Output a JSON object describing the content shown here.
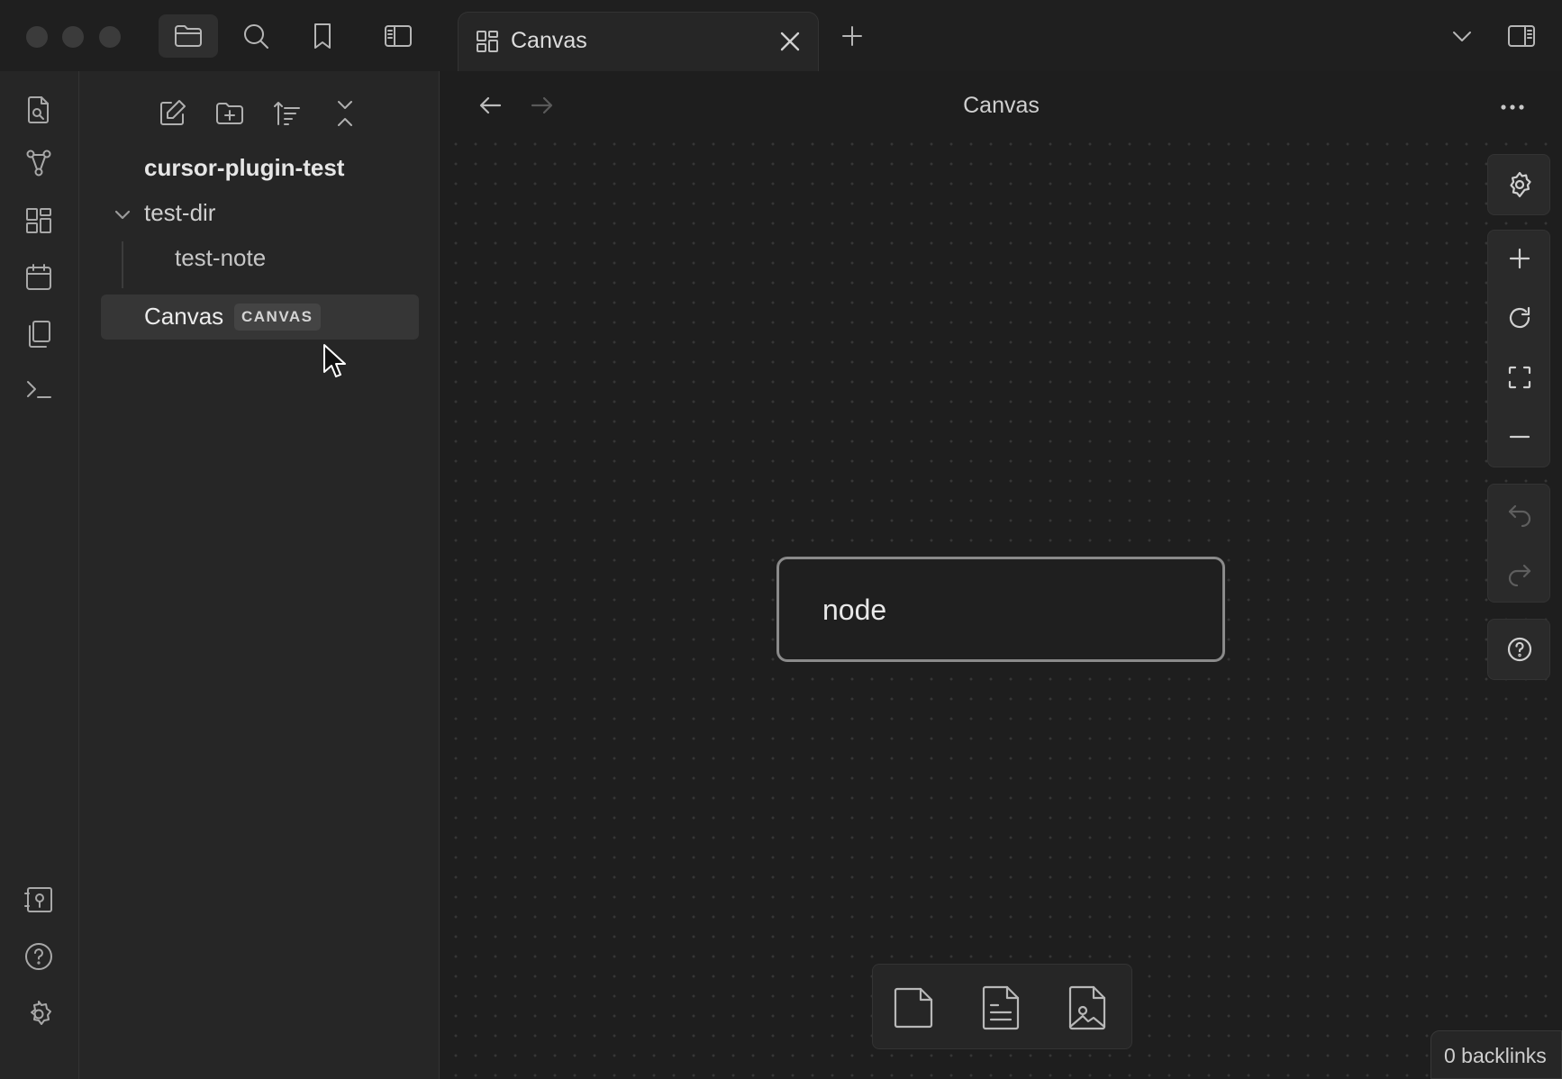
{
  "window": {
    "title": "Canvas"
  },
  "tabs": [
    {
      "label": "Canvas",
      "icon": "canvas-grid-icon",
      "active": true
    }
  ],
  "topbar": {
    "icons": [
      "folder-icon",
      "search-icon",
      "bookmark-icon",
      "sidebar-toggle-icon",
      "new-tab-icon",
      "chevron-down-icon",
      "right-sidebar-toggle-icon"
    ]
  },
  "ribbon": {
    "icons": [
      "quick-switcher-icon",
      "graph-view-icon",
      "canvas-icon",
      "calendar-icon",
      "templates-icon",
      "terminal-icon",
      "vault-switch-icon",
      "help-icon",
      "settings-icon"
    ]
  },
  "sidebar": {
    "toolbar": [
      "new-note-icon",
      "new-folder-icon",
      "sort-icon",
      "collapse-all-icon"
    ],
    "vault_name": "cursor-plugin-test",
    "tree": {
      "folder": "test-dir",
      "note": "test-note",
      "canvas_file": "Canvas",
      "canvas_badge": "CANVAS"
    }
  },
  "view": {
    "title": "Canvas",
    "nav": {
      "back_enabled": true,
      "forward_enabled": false
    }
  },
  "canvas": {
    "node_text": "node",
    "controls": [
      "canvas-settings-icon",
      "zoom-in-icon",
      "reset-zoom-icon",
      "zoom-to-fit-icon",
      "zoom-out-icon",
      "undo-icon",
      "redo-icon",
      "canvas-help-icon"
    ]
  },
  "card_toolbar": [
    "add-card-icon",
    "add-note-icon",
    "add-media-icon"
  ],
  "status": {
    "backlinks": "0 backlinks"
  },
  "colors": {
    "background": "#1e1e1e",
    "panel": "#262626",
    "selected": "#363636",
    "node_border": "#8a8a8a"
  }
}
